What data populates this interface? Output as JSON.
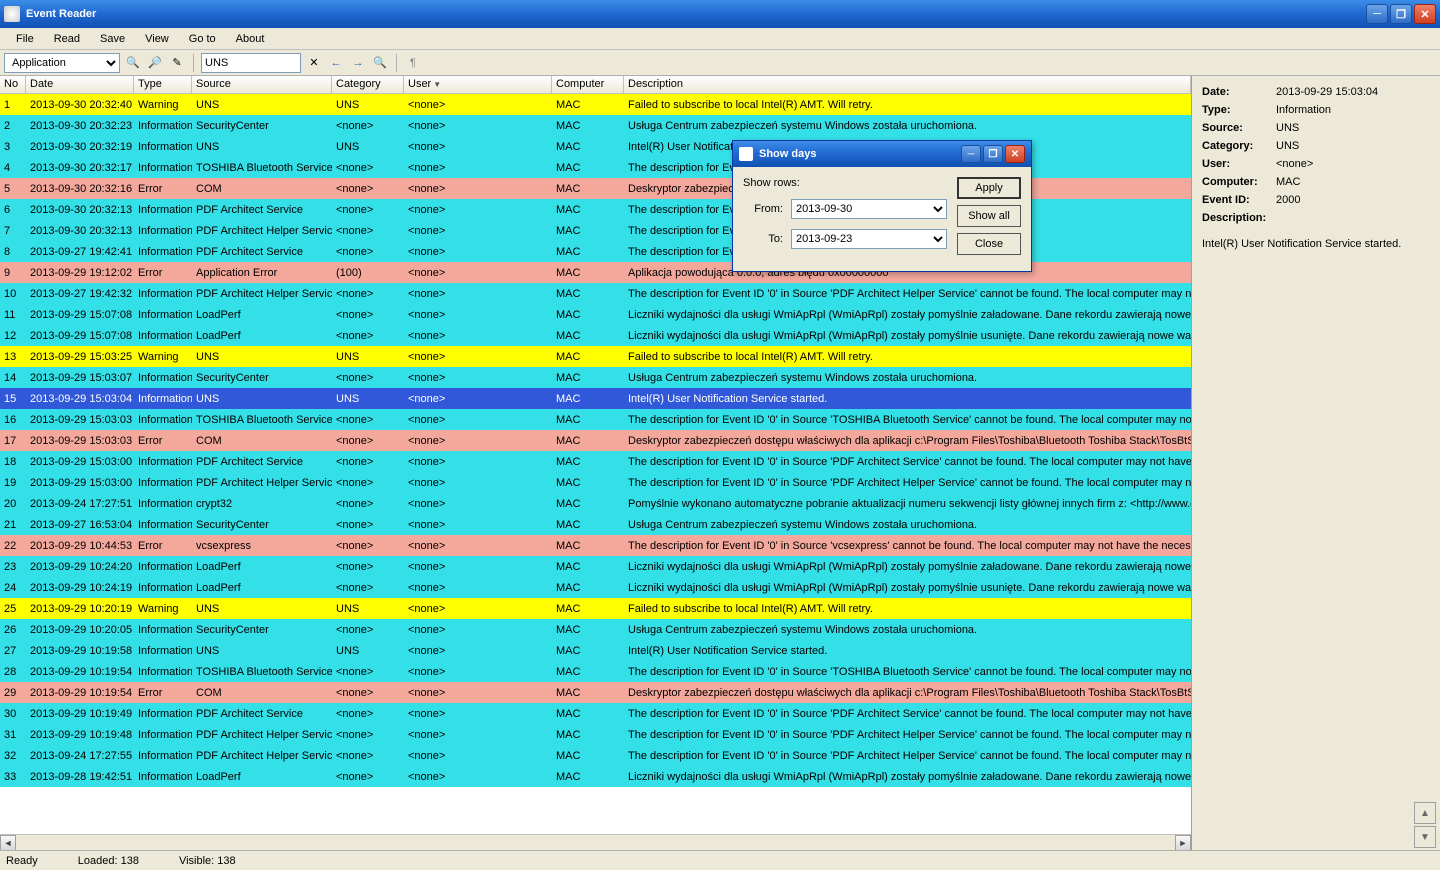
{
  "window": {
    "title": "Event Reader"
  },
  "menu": [
    "File",
    "Read",
    "Save",
    "View",
    "Go to",
    "About"
  ],
  "toolbar": {
    "logSelectValue": "Application",
    "searchValue": "UNS"
  },
  "columns": [
    "No",
    "Date",
    "Type",
    "Source",
    "Category",
    "User",
    "Computer",
    "Description"
  ],
  "selectedRowIndex": 14,
  "rows": [
    {
      "no": 1,
      "date": "2013-09-30 20:32:40",
      "type": "Warning",
      "source": "UNS",
      "category": "UNS",
      "user": "<none>",
      "computer": "MAC",
      "desc": "Failed to subscribe to local Intel(R) AMT. Will retry."
    },
    {
      "no": 2,
      "date": "2013-09-30 20:32:23",
      "type": "Information",
      "source": "SecurityCenter",
      "category": "<none>",
      "user": "<none>",
      "computer": "MAC",
      "desc": "Usługa Centrum zabezpieczeń systemu Windows została uruchomiona."
    },
    {
      "no": 3,
      "date": "2013-09-30 20:32:19",
      "type": "Information",
      "source": "UNS",
      "category": "UNS",
      "user": "<none>",
      "computer": "MAC",
      "desc": "Intel(R) User Notificati"
    },
    {
      "no": 4,
      "date": "2013-09-30 20:32:17",
      "type": "Information",
      "source": "TOSHIBA Bluetooth Service",
      "category": "<none>",
      "user": "<none>",
      "computer": "MAC",
      "desc": "The description for Eve                                                                  The local computer may not ha"
    },
    {
      "no": 5,
      "date": "2013-09-30 20:32:16",
      "type": "Error",
      "source": "COM",
      "category": "<none>",
      "user": "<none>",
      "computer": "MAC",
      "desc": "Deskryptor zabezpiecz                                                                  etooth Toshiba Stack\\TosBtSr"
    },
    {
      "no": 6,
      "date": "2013-09-30 20:32:13",
      "type": "Information",
      "source": "PDF Architect Service",
      "category": "<none>",
      "user": "<none>",
      "computer": "MAC",
      "desc": "The description for Ev                                                                  ocal computer may not have the"
    },
    {
      "no": 7,
      "date": "2013-09-30 20:32:13",
      "type": "Information",
      "source": "PDF Architect Helper Service",
      "category": "<none>",
      "user": "<none>",
      "computer": "MAC",
      "desc": "The description for Ev                                                                  The local computer may not h"
    },
    {
      "no": 8,
      "date": "2013-09-27 19:42:41",
      "type": "Information",
      "source": "PDF Architect Service",
      "category": "<none>",
      "user": "<none>",
      "computer": "MAC",
      "desc": "The description for Ev                                                                  ocal computer may not have the"
    },
    {
      "no": 9,
      "date": "2013-09-29 19:12:02",
      "type": "Error",
      "source": "Application Error",
      "category": "(100)",
      "user": "<none>",
      "computer": "MAC",
      "desc": "Aplikacja powodująca                                                                  0.0.0, adres błędu 0x00000000"
    },
    {
      "no": 10,
      "date": "2013-09-27 19:42:32",
      "type": "Information",
      "source": "PDF Architect Helper Service",
      "category": "<none>",
      "user": "<none>",
      "computer": "MAC",
      "desc": "The description for Event ID '0' in Source 'PDF Architect Helper Service' cannot be found.  The local computer may not h"
    },
    {
      "no": 11,
      "date": "2013-09-29 15:07:08",
      "type": "Information",
      "source": "LoadPerf",
      "category": "<none>",
      "user": "<none>",
      "computer": "MAC",
      "desc": "Liczniki wydajności dla usługi WmiApRpl (WmiApRpl) zostały pomyślnie załadowane. Dane rekordu zawierają nowe wart"
    },
    {
      "no": 12,
      "date": "2013-09-29 15:07:08",
      "type": "Information",
      "source": "LoadPerf",
      "category": "<none>",
      "user": "<none>",
      "computer": "MAC",
      "desc": "Liczniki wydajności dla usługi WmiApRpl (WmiApRpl) zostały pomyślnie usunięte. Dane rekordu zawierają nowe wartoś"
    },
    {
      "no": 13,
      "date": "2013-09-29 15:03:25",
      "type": "Warning",
      "source": "UNS",
      "category": "UNS",
      "user": "<none>",
      "computer": "MAC",
      "desc": "Failed to subscribe to local Intel(R) AMT. Will retry."
    },
    {
      "no": 14,
      "date": "2013-09-29 15:03:07",
      "type": "Information",
      "source": "SecurityCenter",
      "category": "<none>",
      "user": "<none>",
      "computer": "MAC",
      "desc": "Usługa Centrum zabezpieczeń systemu Windows została uruchomiona."
    },
    {
      "no": 15,
      "date": "2013-09-29 15:03:04",
      "type": "Information",
      "source": "UNS",
      "category": "UNS",
      "user": "<none>",
      "computer": "MAC",
      "desc": "Intel(R) User Notification Service started."
    },
    {
      "no": 16,
      "date": "2013-09-29 15:03:03",
      "type": "Information",
      "source": "TOSHIBA Bluetooth Service",
      "category": "<none>",
      "user": "<none>",
      "computer": "MAC",
      "desc": "The description for Event ID '0' in Source 'TOSHIBA Bluetooth Service' cannot be found.  The local computer may not ha"
    },
    {
      "no": 17,
      "date": "2013-09-29 15:03:03",
      "type": "Error",
      "source": "COM",
      "category": "<none>",
      "user": "<none>",
      "computer": "MAC",
      "desc": "Deskryptor zabezpieczeń dostępu właściwych dla aplikacji c:\\Program Files\\Toshiba\\Bluetooth Toshiba Stack\\TosBtSr"
    },
    {
      "no": 18,
      "date": "2013-09-29 15:03:00",
      "type": "Information",
      "source": "PDF Architect Service",
      "category": "<none>",
      "user": "<none>",
      "computer": "MAC",
      "desc": "The description for Event ID '0' in Source 'PDF Architect Service' cannot be found.  The local computer may not have the"
    },
    {
      "no": 19,
      "date": "2013-09-29 15:03:00",
      "type": "Information",
      "source": "PDF Architect Helper Service",
      "category": "<none>",
      "user": "<none>",
      "computer": "MAC",
      "desc": "The description for Event ID '0' in Source 'PDF Architect Helper Service' cannot be found.  The local computer may not h"
    },
    {
      "no": 20,
      "date": "2013-09-24 17:27:51",
      "type": "Information",
      "source": "crypt32",
      "category": "<none>",
      "user": "<none>",
      "computer": "MAC",
      "desc": "Pomyślnie wykonano automatyczne pobranie aktualizacji numeru sekwencji listy głównej innych firm z: <http://www.dow"
    },
    {
      "no": 21,
      "date": "2013-09-27 16:53:04",
      "type": "Information",
      "source": "SecurityCenter",
      "category": "<none>",
      "user": "<none>",
      "computer": "MAC",
      "desc": "Usługa Centrum zabezpieczeń systemu Windows została uruchomiona."
    },
    {
      "no": 22,
      "date": "2013-09-29 10:44:53",
      "type": "Error",
      "source": "vcsexpress",
      "category": "<none>",
      "user": "<none>",
      "computer": "MAC",
      "desc": "The description for Event ID '0' in Source 'vcsexpress' cannot be found.  The local computer may not have the necessar"
    },
    {
      "no": 23,
      "date": "2013-09-29 10:24:20",
      "type": "Information",
      "source": "LoadPerf",
      "category": "<none>",
      "user": "<none>",
      "computer": "MAC",
      "desc": "Liczniki wydajności dla usługi WmiApRpl (WmiApRpl) zostały pomyślnie załadowane. Dane rekordu zawierają nowe wart"
    },
    {
      "no": 24,
      "date": "2013-09-29 10:24:19",
      "type": "Information",
      "source": "LoadPerf",
      "category": "<none>",
      "user": "<none>",
      "computer": "MAC",
      "desc": "Liczniki wydajności dla usługi WmiApRpl (WmiApRpl) zostały pomyślnie usunięte. Dane rekordu zawierają nowe wartoś"
    },
    {
      "no": 25,
      "date": "2013-09-29 10:20:19",
      "type": "Warning",
      "source": "UNS",
      "category": "UNS",
      "user": "<none>",
      "computer": "MAC",
      "desc": "Failed to subscribe to local Intel(R) AMT. Will retry."
    },
    {
      "no": 26,
      "date": "2013-09-29 10:20:05",
      "type": "Information",
      "source": "SecurityCenter",
      "category": "<none>",
      "user": "<none>",
      "computer": "MAC",
      "desc": "Usługa Centrum zabezpieczeń systemu Windows została uruchomiona."
    },
    {
      "no": 27,
      "date": "2013-09-29 10:19:58",
      "type": "Information",
      "source": "UNS",
      "category": "UNS",
      "user": "<none>",
      "computer": "MAC",
      "desc": "Intel(R) User Notification Service started."
    },
    {
      "no": 28,
      "date": "2013-09-29 10:19:54",
      "type": "Information",
      "source": "TOSHIBA Bluetooth Service",
      "category": "<none>",
      "user": "<none>",
      "computer": "MAC",
      "desc": "The description for Event ID '0' in Source 'TOSHIBA Bluetooth Service' cannot be found.  The local computer may not ha"
    },
    {
      "no": 29,
      "date": "2013-09-29 10:19:54",
      "type": "Error",
      "source": "COM",
      "category": "<none>",
      "user": "<none>",
      "computer": "MAC",
      "desc": "Deskryptor zabezpieczeń dostępu właściwych dla aplikacji c:\\Program Files\\Toshiba\\Bluetooth Toshiba Stack\\TosBtSr"
    },
    {
      "no": 30,
      "date": "2013-09-29 10:19:49",
      "type": "Information",
      "source": "PDF Architect Service",
      "category": "<none>",
      "user": "<none>",
      "computer": "MAC",
      "desc": "The description for Event ID '0' in Source 'PDF Architect Service' cannot be found.  The local computer may not have the"
    },
    {
      "no": 31,
      "date": "2013-09-29 10:19:48",
      "type": "Information",
      "source": "PDF Architect Helper Service",
      "category": "<none>",
      "user": "<none>",
      "computer": "MAC",
      "desc": "The description for Event ID '0' in Source 'PDF Architect Helper Service' cannot be found.  The local computer may not h"
    },
    {
      "no": 32,
      "date": "2013-09-24 17:27:55",
      "type": "Information",
      "source": "PDF Architect Helper Service",
      "category": "<none>",
      "user": "<none>",
      "computer": "MAC",
      "desc": "The description for Event ID '0' in Source 'PDF Architect Helper Service' cannot be found.  The local computer may not h"
    },
    {
      "no": 33,
      "date": "2013-09-28 19:42:51",
      "type": "Information",
      "source": "LoadPerf",
      "category": "<none>",
      "user": "<none>",
      "computer": "MAC",
      "desc": "Liczniki wydajności dla usługi WmiApRpl (WmiApRpl) zostały pomyślnie załadowane. Dane rekordu zawierają nowe wart"
    }
  ],
  "details": {
    "labels": {
      "date": "Date:",
      "type": "Type:",
      "source": "Source:",
      "category": "Category:",
      "user": "User:",
      "computer": "Computer:",
      "eventId": "Event ID:",
      "description": "Description:"
    },
    "values": {
      "date": "2013-09-29 15:03:04",
      "type": "Information",
      "source": "UNS",
      "category": "UNS",
      "user": "<none>",
      "computer": "MAC",
      "eventId": "2000"
    },
    "descriptionText": "Intel(R) User Notification Service started."
  },
  "dialog": {
    "title": "Show days",
    "showRowsLabel": "Show rows:",
    "fromLabel": "From:",
    "toLabel": "To:",
    "fromValue": "2013-09-30",
    "toValue": "2013-09-23",
    "apply": "Apply",
    "showAll": "Show all",
    "close": "Close"
  },
  "status": {
    "ready": "Ready",
    "loaded": "Loaded: 138",
    "visible": "Visible: 138"
  }
}
